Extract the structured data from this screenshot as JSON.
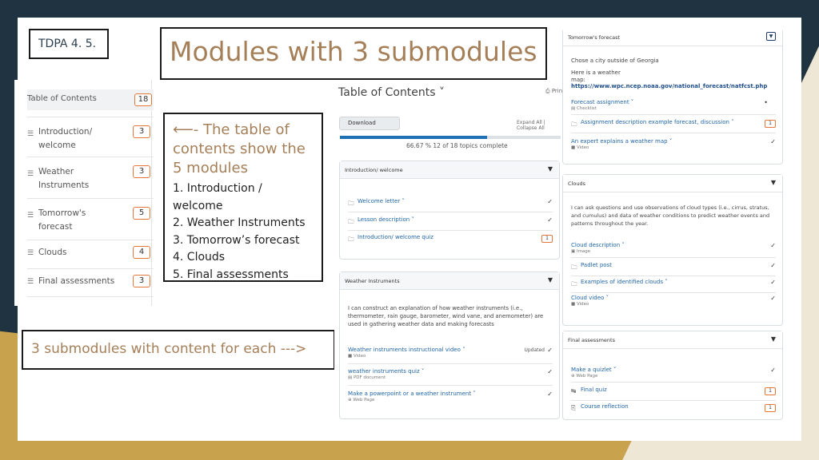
{
  "slide": {
    "tag": "TDPA 4. 5.",
    "title": "Modules with 3 submodules",
    "toc_note_lead": "⟵- The table of contents show the 5 modules",
    "toc_note_items": [
      "1. Introduction / welcome",
      "2. Weather Instruments",
      "3. Tomorrow’s forecast",
      "4. Clouds",
      "5. Final assessments"
    ],
    "submodule_note": "3 submodules with content  for each --->"
  },
  "sidebar": {
    "header": {
      "label": "Table of Contents",
      "count": "18"
    },
    "items": [
      {
        "label": "Introduction/ welcome",
        "count": "3"
      },
      {
        "label": "Weather Instruments",
        "count": "3"
      },
      {
        "label": "Tomorrow's forecast",
        "count": "5"
      },
      {
        "label": "Clouds",
        "count": "4"
      },
      {
        "label": "Final assessments",
        "count": "3"
      }
    ]
  },
  "lms": {
    "title": "Table of Contents ˅",
    "print": "Prin",
    "download": "Download",
    "expand_collapse": "Expand All  |  Collapse All",
    "progress_text": "66.67 %  12 of 18 topics complete",
    "progress_fraction": 0.6667,
    "modules": [
      {
        "title": "Introduction/ welcome",
        "rows": [
          {
            "icon": "folder",
            "name": "Welcome letter ˅",
            "status": "✓"
          },
          {
            "icon": "folder",
            "name": "Lesson description ˅",
            "status": "✓"
          },
          {
            "icon": "folder",
            "name": "Introduction/ welcome quiz",
            "badge": "1"
          }
        ]
      },
      {
        "title": "Weather Instruments",
        "description": "I can construct an explanation of how weather instruments (i.e., thermometer, rain gauge, barometer, wind vane, and anemometer) are used in gathering weather data and making forecasts",
        "rows": [
          {
            "name": "Weather instruments instructional video ˅",
            "sub": "■ Video",
            "updated": "Updated",
            "status": "✓"
          },
          {
            "name": "weather instruments quiz ˅",
            "sub": "▤ PDF document",
            "status": "✓"
          },
          {
            "name": "Make a powerpoint or a weather instrument ˅",
            "sub": "⊕ Web Page",
            "status": "✓"
          }
        ]
      }
    ]
  },
  "right_panel": {
    "forecast": {
      "title": "Tomorrow's forecast",
      "line1": "Chose a city outside of Georgia",
      "line2": "Here is a weather",
      "map_label": "map:",
      "map_url": "https://www.wpc.ncep.noaa.gov/national_forecast/natfcst.php",
      "rows": [
        {
          "name": "Forecast assignment ˅",
          "sub": "▤ Checklist",
          "dot": "•"
        },
        {
          "icon": "folder",
          "name": "Assignment description example forecast, discussion ˅",
          "badge": "1"
        },
        {
          "name": "An expert explains a weather map ˅",
          "sub": "■ Video",
          "status": "✓"
        }
      ]
    },
    "clouds": {
      "title": "Clouds",
      "description": "I can ask questions and use observations of cloud types (i.e., cirrus, stratus, and cumulus) and data of weather conditions to predict weather events and patterns throughout the year.",
      "rows": [
        {
          "name": "Cloud description ˅",
          "sub": "▣ Image",
          "status": "✓"
        },
        {
          "icon": "folder",
          "name": "Padlet post",
          "status": "✓"
        },
        {
          "icon": "folder",
          "name": "Examples of identified clouds ˅",
          "status": "✓"
        },
        {
          "name": "Cloud video ˅",
          "sub": "■ Video",
          "status": "✓"
        }
      ]
    },
    "final": {
      "title": "Final assessments",
      "rows": [
        {
          "name": "Make a quizlet ˅",
          "sub": "⊕ Web Page",
          "status": "✓"
        },
        {
          "icon": "quiz",
          "name": "Final quiz",
          "badge": "1"
        },
        {
          "icon": "reflect",
          "name": "Course reflection",
          "badge": "1"
        }
      ]
    }
  },
  "colors": {
    "accent": "#a57f58",
    "badge_border": "#e2793a",
    "link": "#2166a8",
    "progress": "#1f6fb5",
    "dark_bg": "#1f3340",
    "gold": "#c9a24e"
  }
}
